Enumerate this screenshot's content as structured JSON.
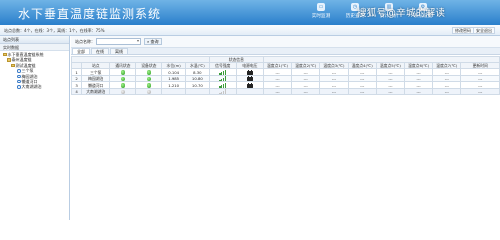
{
  "header": {
    "title": "水下垂直温度链监测系统",
    "nav": [
      {
        "label": "实时监测",
        "icon": "monitor-icon"
      },
      {
        "label": "历史查询",
        "icon": "history-icon"
      },
      {
        "label": "统计分析",
        "icon": "chart-icon"
      },
      {
        "label": "系统设置",
        "icon": "settings-icon"
      }
    ],
    "watermark": "搜狐号@辛城的解读"
  },
  "subbar": {
    "status": "站点总数：4个，在线：3个，离线：1个，在线率：75%",
    "util_buttons": [
      {
        "label": "修改密码"
      },
      {
        "label": "安全退出"
      }
    ]
  },
  "sidebar": {
    "header": "站点列表",
    "panel_label": "实时数据",
    "tree": [
      {
        "label": "水下垂直温度链系统",
        "level": 0,
        "type": "folder"
      },
      {
        "label": "泰州温度链",
        "level": 1,
        "type": "folder"
      },
      {
        "label": "测试温度链",
        "level": 2,
        "type": "folder"
      },
      {
        "label": "三个泵",
        "level": 3,
        "type": "device"
      },
      {
        "label": "梅园湖泊",
        "level": 3,
        "type": "device"
      },
      {
        "label": "懒道河口",
        "level": 3,
        "type": "device"
      },
      {
        "label": "大南湖湖泊",
        "level": 3,
        "type": "device"
      }
    ]
  },
  "search": {
    "label": "站点名称：",
    "value": "",
    "button_label": "查询"
  },
  "tabs": [
    {
      "label": "全部",
      "active": true
    },
    {
      "label": "在线",
      "active": false
    },
    {
      "label": "离线",
      "active": false
    }
  ],
  "table": {
    "group_header": "状态信息",
    "headers": [
      "",
      "站点",
      "通讯状态",
      "设备状态",
      "水位(m)",
      "水温(℃)",
      "信号强度",
      "电源电压",
      "温度点1(℃)",
      "温度点2(℃)",
      "温度点3(℃)",
      "温度点4(℃)",
      "温度点5(℃)",
      "温度点6(℃)",
      "温度点7(℃)",
      "更新时间"
    ],
    "rows": [
      {
        "no": "1",
        "name": "三个泵",
        "comm": "online",
        "dev": "online",
        "level": "0.104",
        "temp": "8.30",
        "signal": "strong",
        "power": "ok",
        "vals": [
          "---",
          "---",
          "---",
          "---",
          "---",
          "---",
          "---",
          "---"
        ]
      },
      {
        "no": "2",
        "name": "梅园湖泊",
        "comm": "online",
        "dev": "online",
        "level": "1.985",
        "temp": "10.80",
        "signal": "strong",
        "power": "ok",
        "vals": [
          "---",
          "---",
          "---",
          "---",
          "---",
          "---",
          "---",
          "---"
        ]
      },
      {
        "no": "3",
        "name": "懒道河口",
        "comm": "online",
        "dev": "online",
        "level": "1.210",
        "temp": "10.70",
        "signal": "strong",
        "power": "ok",
        "vals": [
          "---",
          "---",
          "---",
          "---",
          "---",
          "---",
          "---",
          "---"
        ]
      },
      {
        "no": "4",
        "name": "大南湖湖泊",
        "comm": "offline",
        "dev": "offline",
        "level": "",
        "temp": "",
        "signal": "none",
        "power": "none",
        "vals": [
          "---",
          "---",
          "---",
          "---",
          "---",
          "---",
          "---",
          "---"
        ]
      }
    ]
  },
  "colors": {
    "header_top": "#6fb3e6",
    "header_bottom": "#2a7fcb",
    "online": "#2c9c23",
    "offline": "#a9a9a9"
  }
}
